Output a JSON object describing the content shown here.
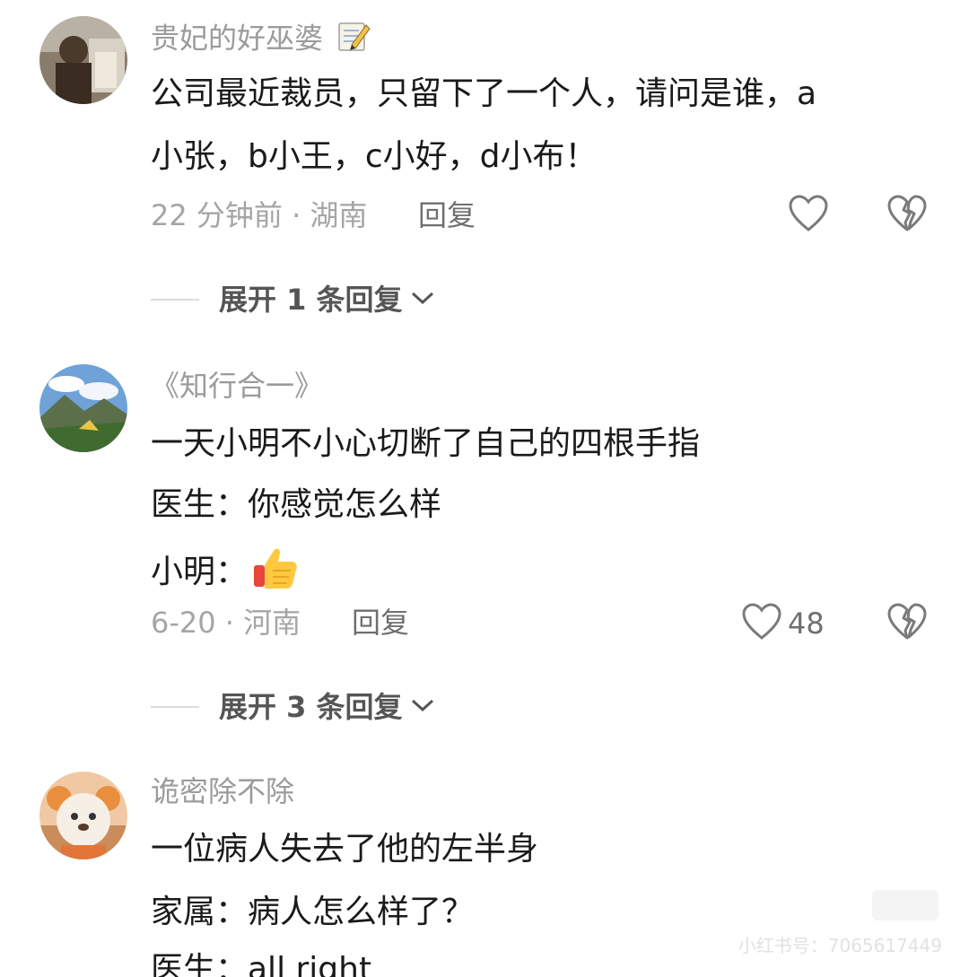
{
  "comments": [
    {
      "username": "贵妃的好巫婆",
      "username_badge_icon": "memo-pencil-icon",
      "lines": [
        "公司最近裁员，只留下了一个人，请问是谁，a",
        "小张，b小王，c小好，d小布！"
      ],
      "meta": "22 分钟前 · 湖南",
      "reply_label": "回复",
      "like_count": "",
      "expand_label": "展开 1 条回复"
    },
    {
      "username": "《知行合一》",
      "lines": [
        "一天小明不小心切断了自己的四根手指",
        "医生：你感觉怎么样",
        "小明："
      ],
      "emoji_icon": "thumbs-up-emoji-icon",
      "meta": "6-20 · 河南",
      "reply_label": "回复",
      "like_count": "48",
      "expand_label": "展开 3 条回复"
    },
    {
      "username": "诡密除不除",
      "lines": [
        "一位病人失去了他的左半身",
        "家属：病人怎么样了？",
        "医生：all right"
      ]
    }
  ],
  "watermark": "小红书号：7065617449",
  "colors": {
    "username": "#9b9b9b",
    "body_text": "#1a1a1a",
    "meta": "#a5a5a5"
  }
}
